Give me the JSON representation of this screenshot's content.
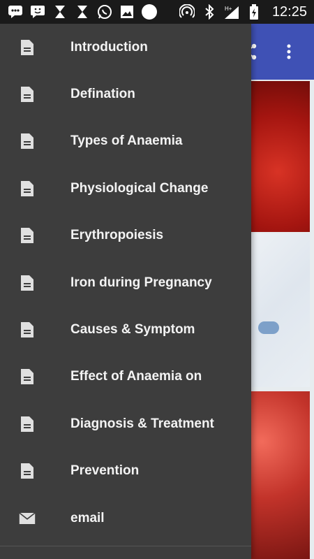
{
  "status_bar": {
    "time": "12:25",
    "left_icons": [
      "chat-bubble-icon",
      "smiley-message-icon",
      "hourglass-icon",
      "hourglass-icon",
      "whatsapp-icon",
      "image-icon",
      "circle-icon"
    ],
    "right_icons": [
      "hotspot-icon",
      "bluetooth-icon",
      "signal-hplus-icon",
      "battery-icon"
    ],
    "network_label": "H+"
  },
  "app_toolbar": {
    "color": "#3f51b5",
    "actions": [
      "share-icon",
      "overflow-menu-icon"
    ]
  },
  "drawer": {
    "background": "#3d3d3d",
    "items": [
      {
        "label": "Introduction",
        "icon": "document-icon"
      },
      {
        "label": "Defination",
        "icon": "document-icon"
      },
      {
        "label": "Types of Anaemia",
        "icon": "document-icon"
      },
      {
        "label": "Physiological Change",
        "icon": "document-icon"
      },
      {
        "label": "Erythropoiesis",
        "icon": "document-icon"
      },
      {
        "label": "Iron during Pregnancy",
        "icon": "document-icon"
      },
      {
        "label": "Causes & Symptom",
        "icon": "document-icon"
      },
      {
        "label": "Effect of Anaemia on",
        "icon": "document-icon"
      },
      {
        "label": "Diagnosis & Treatment",
        "icon": "document-icon"
      },
      {
        "label": "Prevention",
        "icon": "document-icon"
      },
      {
        "label": "email",
        "icon": "mail-icon"
      }
    ]
  }
}
